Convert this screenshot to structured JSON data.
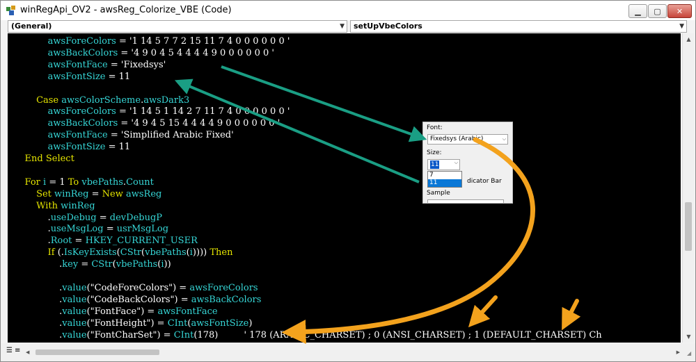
{
  "window": {
    "title": "winRegApi_OV2 - awsReg_Colorize_VBE (Code)",
    "controls": {
      "minimize": "▁",
      "maximize": "▢",
      "close": "✕"
    }
  },
  "combos": {
    "object": "(General)",
    "procedure": "setUpVbeColors"
  },
  "code_lines": [
    {
      "indent": "            ",
      "parts": [
        {
          "t": "awsForeColors",
          "c": "id"
        },
        {
          "t": " = '1 14 5 7 7 2 15 11 7 4 0 0 0 0 0 0 '",
          "c": "wh"
        }
      ]
    },
    {
      "indent": "            ",
      "parts": [
        {
          "t": "awsBackColors",
          "c": "id"
        },
        {
          "t": " = '4 9 0 4 5 4 4 4 4 9 0 0 0 0 0 0 '",
          "c": "wh"
        }
      ]
    },
    {
      "indent": "            ",
      "parts": [
        {
          "t": "awsFontFace",
          "c": "id"
        },
        {
          "t": " = 'Fixedsys'",
          "c": "wh"
        }
      ]
    },
    {
      "indent": "            ",
      "parts": [
        {
          "t": "awsFontSize",
          "c": "id"
        },
        {
          "t": " = 11",
          "c": "wh"
        }
      ]
    },
    {
      "indent": "",
      "parts": []
    },
    {
      "indent": "        ",
      "parts": [
        {
          "t": "Case ",
          "c": "kw"
        },
        {
          "t": "awsColorScheme",
          "c": "id"
        },
        {
          "t": ".",
          "c": "wh"
        },
        {
          "t": "awsDark3",
          "c": "id"
        }
      ]
    },
    {
      "indent": "            ",
      "parts": [
        {
          "t": "awsForeColors",
          "c": "id"
        },
        {
          "t": " = '1 14 5 1 14 2 7 11 7 4 0 0 0 0 0 0 '",
          "c": "wh"
        }
      ]
    },
    {
      "indent": "            ",
      "parts": [
        {
          "t": "awsBackColors",
          "c": "id"
        },
        {
          "t": " = '4 9 4 5 15 4 4 4 4 9 0 0 0 0 0 0 '",
          "c": "wh"
        }
      ]
    },
    {
      "indent": "            ",
      "parts": [
        {
          "t": "awsFontFace",
          "c": "id"
        },
        {
          "t": " = 'Simplified Arabic Fixed'",
          "c": "wh"
        }
      ]
    },
    {
      "indent": "            ",
      "parts": [
        {
          "t": "awsFontSize",
          "c": "id"
        },
        {
          "t": " = 11",
          "c": "wh"
        }
      ]
    },
    {
      "indent": "    ",
      "parts": [
        {
          "t": "End Select",
          "c": "kw"
        }
      ]
    },
    {
      "indent": "",
      "parts": []
    },
    {
      "indent": "    ",
      "parts": [
        {
          "t": "For ",
          "c": "kw"
        },
        {
          "t": "i",
          "c": "id"
        },
        {
          "t": " = 1 ",
          "c": "wh"
        },
        {
          "t": "To ",
          "c": "kw"
        },
        {
          "t": "vbePaths",
          "c": "id"
        },
        {
          "t": ".",
          "c": "wh"
        },
        {
          "t": "Count",
          "c": "id"
        }
      ]
    },
    {
      "indent": "        ",
      "parts": [
        {
          "t": "Set ",
          "c": "kw"
        },
        {
          "t": "winReg",
          "c": "id"
        },
        {
          "t": " = ",
          "c": "wh"
        },
        {
          "t": "New ",
          "c": "kw"
        },
        {
          "t": "awsReg",
          "c": "id"
        }
      ]
    },
    {
      "indent": "        ",
      "parts": [
        {
          "t": "With ",
          "c": "kw"
        },
        {
          "t": "winReg",
          "c": "id"
        }
      ]
    },
    {
      "indent": "            ",
      "parts": [
        {
          "t": ".",
          "c": "wh"
        },
        {
          "t": "useDebug",
          "c": "id"
        },
        {
          "t": " = ",
          "c": "wh"
        },
        {
          "t": "devDebugP",
          "c": "id"
        }
      ]
    },
    {
      "indent": "            ",
      "parts": [
        {
          "t": ".",
          "c": "wh"
        },
        {
          "t": "useMsgLog",
          "c": "id"
        },
        {
          "t": " = ",
          "c": "wh"
        },
        {
          "t": "usrMsgLog",
          "c": "id"
        }
      ]
    },
    {
      "indent": "            ",
      "parts": [
        {
          "t": ".",
          "c": "wh"
        },
        {
          "t": "Root",
          "c": "id"
        },
        {
          "t": " = ",
          "c": "wh"
        },
        {
          "t": "HKEY_CURRENT_USER",
          "c": "id"
        }
      ]
    },
    {
      "indent": "            ",
      "parts": [
        {
          "t": "If ",
          "c": "kw"
        },
        {
          "t": "(.",
          "c": "wh"
        },
        {
          "t": "IsKeyExists",
          "c": "id"
        },
        {
          "t": "(",
          "c": "wh"
        },
        {
          "t": "CStr",
          "c": "id"
        },
        {
          "t": "(",
          "c": "wh"
        },
        {
          "t": "vbePaths",
          "c": "id"
        },
        {
          "t": "(",
          "c": "wh"
        },
        {
          "t": "i",
          "c": "id"
        },
        {
          "t": ")))) ",
          "c": "wh"
        },
        {
          "t": "Then",
          "c": "kw"
        }
      ]
    },
    {
      "indent": "                ",
      "parts": [
        {
          "t": ".",
          "c": "wh"
        },
        {
          "t": "key",
          "c": "id"
        },
        {
          "t": " = ",
          "c": "wh"
        },
        {
          "t": "CStr",
          "c": "id"
        },
        {
          "t": "(",
          "c": "wh"
        },
        {
          "t": "vbePaths",
          "c": "id"
        },
        {
          "t": "(",
          "c": "wh"
        },
        {
          "t": "i",
          "c": "id"
        },
        {
          "t": "))",
          "c": "wh"
        }
      ]
    },
    {
      "indent": "",
      "parts": []
    },
    {
      "indent": "                ",
      "parts": [
        {
          "t": ".",
          "c": "wh"
        },
        {
          "t": "value",
          "c": "id"
        },
        {
          "t": "(\"CodeForeColors\") = ",
          "c": "wh"
        },
        {
          "t": "awsForeColors",
          "c": "id"
        }
      ]
    },
    {
      "indent": "                ",
      "parts": [
        {
          "t": ".",
          "c": "wh"
        },
        {
          "t": "value",
          "c": "id"
        },
        {
          "t": "(\"CodeBackColors\") = ",
          "c": "wh"
        },
        {
          "t": "awsBackColors",
          "c": "id"
        }
      ]
    },
    {
      "indent": "                ",
      "parts": [
        {
          "t": ".",
          "c": "wh"
        },
        {
          "t": "value",
          "c": "id"
        },
        {
          "t": "(\"FontFace\") = ",
          "c": "wh"
        },
        {
          "t": "awsFontFace",
          "c": "id"
        }
      ]
    },
    {
      "indent": "                ",
      "parts": [
        {
          "t": ".",
          "c": "wh"
        },
        {
          "t": "value",
          "c": "id"
        },
        {
          "t": "(\"FontHeight\") = ",
          "c": "wh"
        },
        {
          "t": "CInt",
          "c": "id"
        },
        {
          "t": "(",
          "c": "wh"
        },
        {
          "t": "awsFontSize",
          "c": "id"
        },
        {
          "t": ")",
          "c": "wh"
        }
      ]
    },
    {
      "indent": "                ",
      "parts": [
        {
          "t": ".",
          "c": "wh"
        },
        {
          "t": "value",
          "c": "id"
        },
        {
          "t": "(\"FontCharSet\") = ",
          "c": "wh"
        },
        {
          "t": "CInt",
          "c": "id"
        },
        {
          "t": "(178)",
          "c": "wh"
        },
        {
          "t": "         ' 178 (ARABIC_CHARSET) ; 0 (ANSI_CHARSET) ; 1 (DEFAULT_CHARSET) Ch",
          "c": "wh"
        }
      ]
    }
  ],
  "font_popup": {
    "font_label": "Font:",
    "font_value": "Fixedsys (Arabic)",
    "size_label": "Size:",
    "size_value": "11",
    "size_options": [
      "7",
      "11"
    ],
    "selected_option": "11",
    "indicator_text": "dicator Bar",
    "sample_label": "Sample"
  },
  "colors": {
    "keyword": "#e6e600",
    "identifier": "#36d6d6",
    "plain": "#ffffff",
    "code_bg": "#000000",
    "teal_arrow": "#1a9e84",
    "orange_arrow": "#f3a21d"
  }
}
